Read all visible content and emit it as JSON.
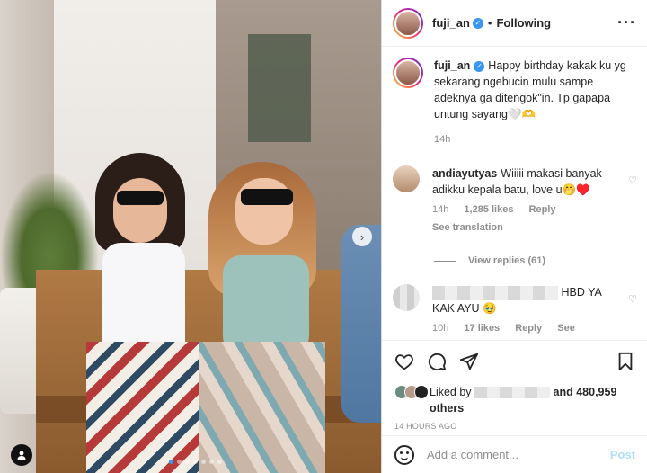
{
  "post": {
    "username": "fuji_an",
    "following_label": "Following",
    "more_label": "···",
    "caption": "Happy birthday kakak ku yg sekarang ngebucin mulu sampe adeknya ga ditengok\"in. Tp gapapa untung sayang🤍🫶",
    "caption_time": "14h"
  },
  "comments": [
    {
      "username": "andiayutyas",
      "text": "Wiiiii makasi banyak adikku kepala batu, love u🤭♥️",
      "time": "14h",
      "likes": "1,285 likes",
      "reply_label": "Reply",
      "translation_label": "See translation",
      "view_replies": "View replies (61)"
    },
    {
      "username": "",
      "text": "HBD YA KAK AYU 🥹",
      "time": "10h",
      "likes": "17 likes",
      "reply_label": "Reply",
      "translation_label": "See translation"
    }
  ],
  "likes": {
    "prefix": "Liked by",
    "and_text": "and 480,959",
    "others": "others"
  },
  "timestamp": "14 HOURS AGO",
  "add_comment": {
    "placeholder": "Add a comment...",
    "post_label": "Post"
  },
  "photo": {
    "next_arrow": "›",
    "carousel_total": 7,
    "carousel_active": 1
  },
  "colors": {
    "link_blue": "#3897f0",
    "post_disabled": "#b2dffc",
    "muted": "#8e8e8e"
  },
  "icons": [
    "heart-icon",
    "comment-icon",
    "share-icon",
    "bookmark-icon",
    "emoji-icon",
    "verified-icon",
    "more-icon",
    "user-tag-icon",
    "next-arrow-icon"
  ]
}
